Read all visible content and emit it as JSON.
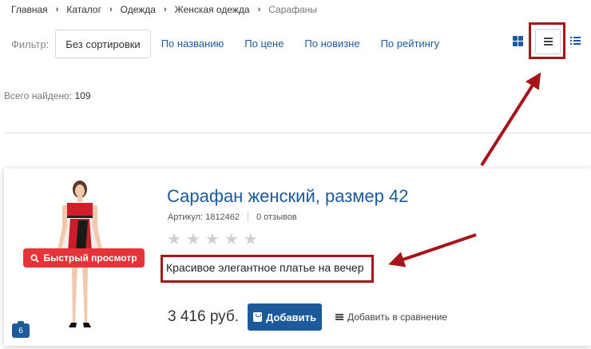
{
  "breadcrumb": [
    {
      "label": "Главная"
    },
    {
      "label": "Каталог"
    },
    {
      "label": "Одежда"
    },
    {
      "label": "Женская одежда"
    },
    {
      "label": "Сарафаны"
    }
  ],
  "filter": {
    "label": "Фильтр:",
    "options": [
      {
        "label": "Без сортировки",
        "active": true
      },
      {
        "label": "По названию"
      },
      {
        "label": "По цене"
      },
      {
        "label": "По новизне"
      },
      {
        "label": "По рейтингу"
      }
    ]
  },
  "view_modes": {
    "tile_icon": "grid-icon",
    "list_icon": "list-lines-icon",
    "compact_icon": "compact-list-icon",
    "selected": "list"
  },
  "results": {
    "label": "Всего найдено:",
    "count": "109"
  },
  "product": {
    "title": "Сарафан женский, размер 42",
    "sku": "Артикул: 1812462",
    "reviews": "0 отзывов",
    "rating": 0,
    "rating_max": 5,
    "description": "Красивое элегантное платье на вечер",
    "price": "3 416 руб.",
    "add_label": "Добавить",
    "compare_label": "Добавить в сравнение",
    "quickview_label": "Быстрый просмотр",
    "photo_count": "6"
  },
  "colors": {
    "link": "#1c5a9c",
    "quickview": "#e5333a",
    "annotation": "#a4141a"
  }
}
